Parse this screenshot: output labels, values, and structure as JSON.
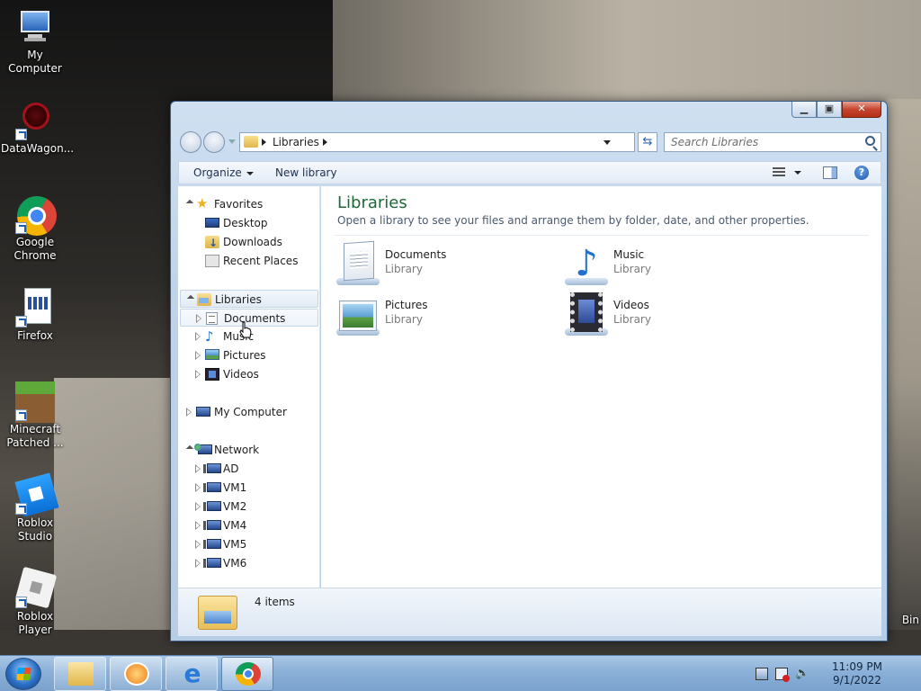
{
  "desktop": {
    "icons": [
      {
        "label": "My Computer",
        "icon": "computer-icon"
      },
      {
        "label": "DataWagon...",
        "icon": "datawagon-icon"
      },
      {
        "label": "Google Chrome",
        "icon": "chrome-icon"
      },
      {
        "label": "Firefox",
        "icon": "firefox-icon"
      },
      {
        "label": "Minecraft Patched ...",
        "icon": "minecraft-icon"
      },
      {
        "label": "Roblox Studio",
        "icon": "roblox-studio-icon"
      },
      {
        "label": "Roblox Player",
        "icon": "roblox-player-icon"
      }
    ],
    "recycle_bin_partial": "Bin"
  },
  "explorer": {
    "address": {
      "crumb": "Libraries"
    },
    "search": {
      "placeholder": "Search Libraries"
    },
    "toolbar": {
      "organize": "Organize",
      "new_library": "New library"
    },
    "nav": {
      "favorites": {
        "label": "Favorites",
        "items": [
          "Desktop",
          "Downloads",
          "Recent Places"
        ]
      },
      "libraries": {
        "label": "Libraries",
        "items": [
          "Documents",
          "Music",
          "Pictures",
          "Videos"
        ]
      },
      "computer": {
        "label": "My Computer"
      },
      "network": {
        "label": "Network",
        "items": [
          "AD",
          "VM1",
          "VM2",
          "VM4",
          "VM5",
          "VM6"
        ]
      }
    },
    "content": {
      "title": "Libraries",
      "description": "Open a library to see your files and arrange them by folder, date, and other properties.",
      "libraries": [
        {
          "name": "Documents",
          "kind": "Library",
          "icon": "documents-library-icon"
        },
        {
          "name": "Music",
          "kind": "Library",
          "icon": "music-library-icon"
        },
        {
          "name": "Pictures",
          "kind": "Library",
          "icon": "pictures-library-icon"
        },
        {
          "name": "Videos",
          "kind": "Library",
          "icon": "videos-library-icon"
        }
      ]
    },
    "status": {
      "count": "4 items"
    }
  },
  "taskbar": {
    "pinned": [
      "file-explorer-icon",
      "media-player-icon",
      "internet-explorer-icon",
      "chrome-icon"
    ],
    "active": "chrome-icon",
    "clock": {
      "time": "11:09 PM",
      "date": "9/1/2022"
    }
  },
  "colors": {
    "library_title": "#1e6a37",
    "accent": "#2874d1"
  }
}
